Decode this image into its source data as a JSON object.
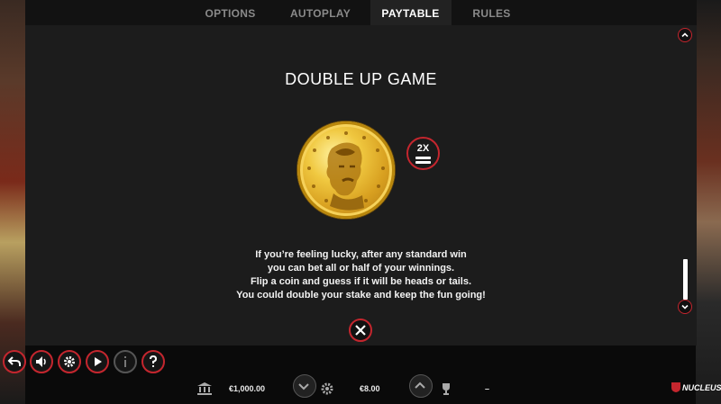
{
  "tabs": [
    {
      "label": "OPTIONS"
    },
    {
      "label": "AUTOPLAY"
    },
    {
      "label": "PAYTABLE",
      "active": true
    },
    {
      "label": "RULES"
    }
  ],
  "panel": {
    "title": "DOUBLE UP GAME",
    "badge": "2X",
    "description": [
      "If you’re feeling lucky, after any standard win",
      "you can bet all or half of your winnings.",
      "Flip a coin and guess if it will be heads or tails.",
      "You could double your stake and keep the fun going!"
    ]
  },
  "status": {
    "balance": "€1,000.00",
    "bet": "€8.00",
    "win": "–",
    "brand": "NUCLEUS"
  },
  "colors": {
    "accent": "#c4262e",
    "panel_bg": "#1c1c1c",
    "menu_bg": "#121212",
    "coin_gold": "#e0b030"
  },
  "icons": {
    "back": "back-arrow-icon",
    "sound": "speaker-icon",
    "settings": "gear-icon",
    "autoplay": "play-icon",
    "info": "info-icon",
    "help": "question-icon",
    "balance": "bank-icon",
    "bet": "coin-stack-icon",
    "win": "trophy-icon"
  }
}
